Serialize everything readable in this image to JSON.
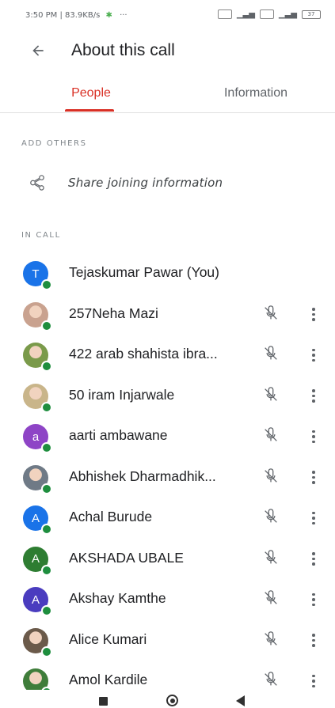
{
  "status_bar": {
    "time_speed": "3:50 PM | 83.9KB/s",
    "more": "···",
    "battery": "37"
  },
  "app_bar": {
    "title": "About this call"
  },
  "tabs": [
    {
      "label": "People",
      "selected": true
    },
    {
      "label": "Information",
      "selected": false
    }
  ],
  "add_others": {
    "header": "ADD OTHERS",
    "share_label": "Share joining information"
  },
  "in_call": {
    "header": "IN CALL",
    "participants": [
      {
        "name": "Tejaskumar Pawar (You)",
        "initial": "T",
        "avatar_color": "#1a73e8",
        "muted_icon": false,
        "more_icon": false
      },
      {
        "name": "257Neha Mazi",
        "initial": "",
        "avatar_color": "#c9a28f",
        "muted_icon": true,
        "more_icon": true
      },
      {
        "name": "422 arab shahista ibra...",
        "initial": "",
        "avatar_color": "#7a9a4a",
        "muted_icon": true,
        "more_icon": true
      },
      {
        "name": "50 iram Injarwale",
        "initial": "",
        "avatar_color": "#c9b58a",
        "muted_icon": true,
        "more_icon": true
      },
      {
        "name": "aarti ambawane",
        "initial": "a",
        "avatar_color": "#8e44c6",
        "muted_icon": true,
        "more_icon": true
      },
      {
        "name": "Abhishek Dharmadhik...",
        "initial": "",
        "avatar_color": "#6f7a86",
        "muted_icon": true,
        "more_icon": true
      },
      {
        "name": "Achal Burude",
        "initial": "A",
        "avatar_color": "#1a73e8",
        "muted_icon": true,
        "more_icon": true
      },
      {
        "name": "AKSHADA UBALE",
        "initial": "A",
        "avatar_color": "#2e7d32",
        "muted_icon": true,
        "more_icon": true
      },
      {
        "name": "Akshay Kamthe",
        "initial": "A",
        "avatar_color": "#4a3cbf",
        "muted_icon": true,
        "more_icon": true
      },
      {
        "name": "Alice Kumari",
        "initial": "",
        "avatar_color": "#6b5a4a",
        "muted_icon": true,
        "more_icon": true
      },
      {
        "name": "Amol Kardile",
        "initial": "",
        "avatar_color": "#3f7d3a",
        "muted_icon": true,
        "more_icon": true
      }
    ]
  },
  "colors": {
    "accent": "#d93025",
    "presence": "#1e8e3e",
    "icon": "#5f6368"
  },
  "icons": {
    "back": "arrow-left-icon",
    "share": "share-icon",
    "mic_off": "mic-off-icon",
    "more": "more-vertical-icon"
  }
}
